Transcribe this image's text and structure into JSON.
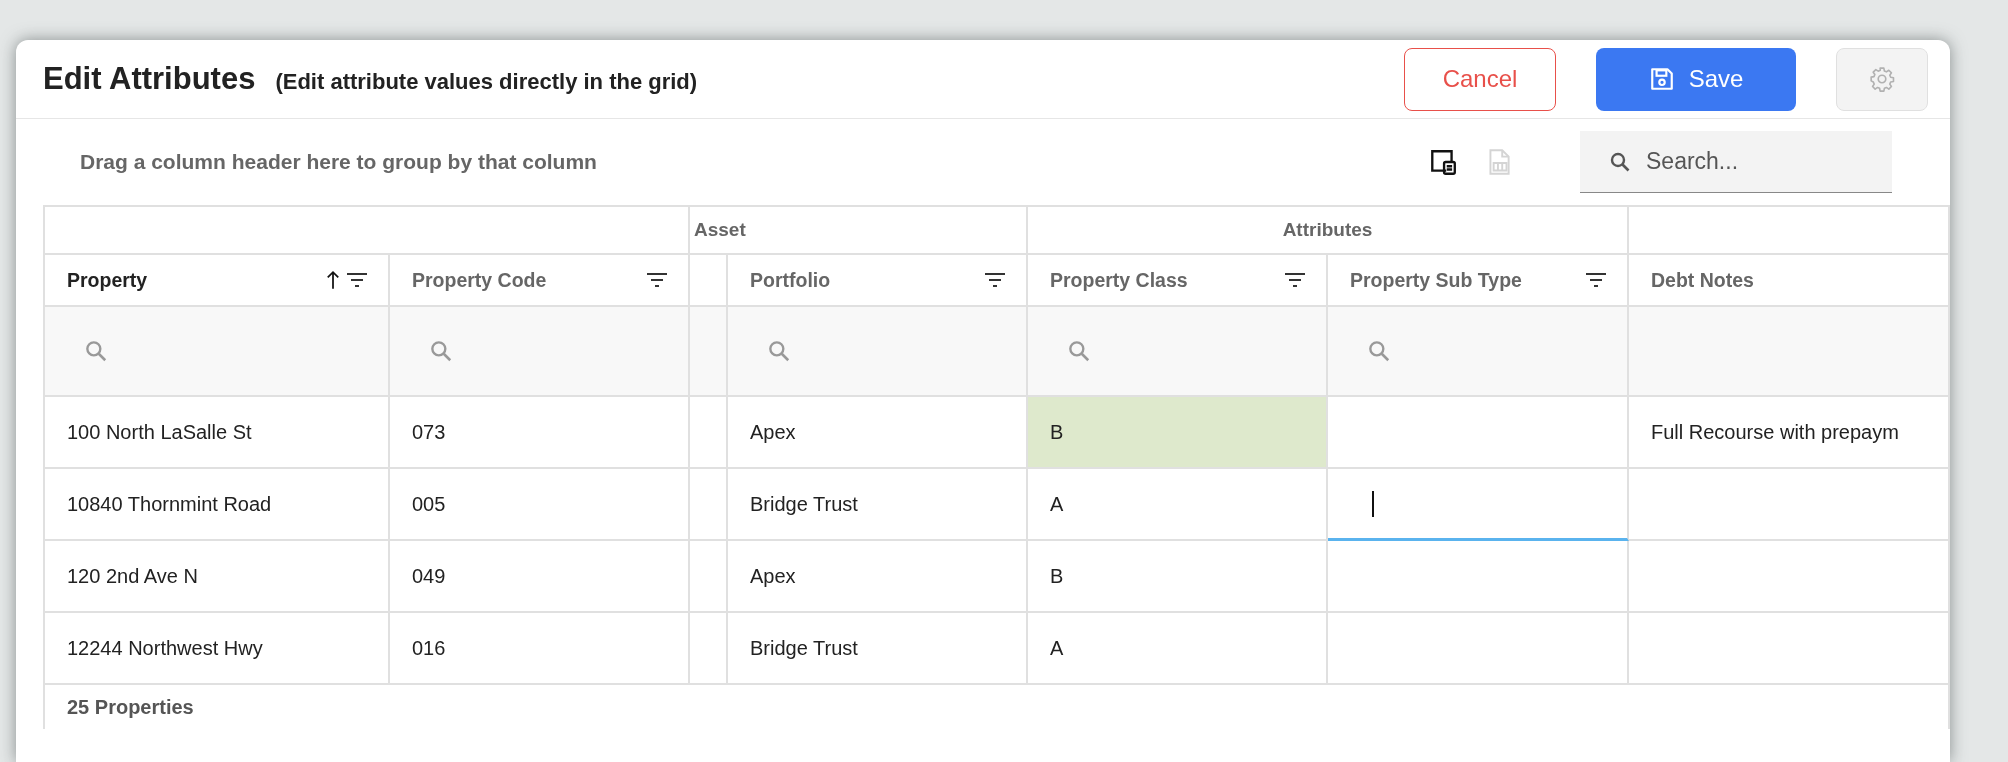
{
  "dialog": {
    "title": "Edit Attributes",
    "subtitle": "(Edit attribute values directly in the grid)"
  },
  "buttons": [
    {
      "kind": "cancel",
      "label": "Cancel",
      "disabled": false
    },
    {
      "kind": "save",
      "label": "Save",
      "disabled": false
    },
    {
      "kind": "settings",
      "disabled": true
    }
  ],
  "toolbar": {
    "group_hint": "Drag a column header here to group by that column",
    "tools": [
      {
        "kind": "column-chooser",
        "disabled": false
      },
      {
        "kind": "export",
        "disabled": true
      }
    ],
    "search": {
      "placeholder": "Search..."
    }
  },
  "grid": {
    "bands": [
      {
        "label": "Asset"
      },
      {
        "label": "Attributes"
      }
    ],
    "columns": [
      {
        "label": "Property",
        "sorted": true,
        "filter": true,
        "searchable": true
      },
      {
        "label": "Property Code",
        "sorted": false,
        "filter": true,
        "searchable": true
      },
      {
        "label": "Portfolio",
        "sorted": false,
        "filter": true,
        "searchable": true
      },
      {
        "label": "Property Class",
        "sorted": false,
        "filter": true,
        "searchable": true
      },
      {
        "label": "Property Sub Type",
        "sorted": false,
        "filter": true,
        "searchable": true
      },
      {
        "label": "Debt Notes",
        "sorted": false,
        "filter": false,
        "searchable": false
      }
    ],
    "rows": [
      {
        "cells": [
          {
            "text": "100 North LaSalle St",
            "modified": false,
            "editing": false
          },
          {
            "text": "073",
            "modified": false,
            "editing": false
          },
          {
            "text": "Apex",
            "modified": false,
            "editing": false
          },
          {
            "text": "B",
            "modified": true,
            "editing": false
          },
          {
            "modified": false,
            "editing": false
          },
          {
            "text": "Full Recourse with prepaym",
            "modified": false,
            "editing": false
          }
        ]
      },
      {
        "cells": [
          {
            "text": "10840 Thornmint Road",
            "modified": false,
            "editing": false
          },
          {
            "text": "005",
            "modified": false,
            "editing": false
          },
          {
            "text": "Bridge Trust",
            "modified": false,
            "editing": false
          },
          {
            "text": "A",
            "modified": false,
            "editing": false
          },
          {
            "modified": false,
            "editing": true
          },
          {
            "modified": false,
            "editing": false
          }
        ]
      },
      {
        "cells": [
          {
            "text": "120 2nd Ave N",
            "modified": false,
            "editing": false
          },
          {
            "text": "049",
            "modified": false,
            "editing": false
          },
          {
            "text": "Apex",
            "modified": false,
            "editing": false
          },
          {
            "text": "B",
            "modified": false,
            "editing": false
          },
          {
            "modified": false,
            "editing": false
          },
          {
            "modified": false,
            "editing": false
          }
        ]
      },
      {
        "cells": [
          {
            "text": "12244 Northwest Hwy",
            "modified": false,
            "editing": false
          },
          {
            "text": "016",
            "modified": false,
            "editing": false
          },
          {
            "text": "Bridge Trust",
            "modified": false,
            "editing": false
          },
          {
            "text": "A",
            "modified": false,
            "editing": false
          },
          {
            "modified": false,
            "editing": false
          },
          {
            "modified": false,
            "editing": false
          }
        ]
      }
    ],
    "footer": "25 Properties"
  }
}
